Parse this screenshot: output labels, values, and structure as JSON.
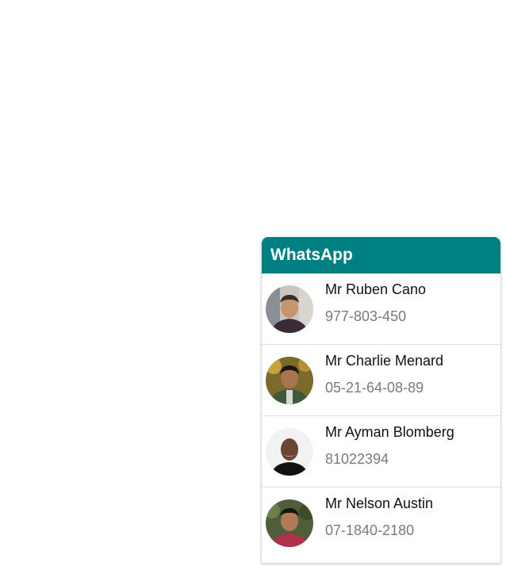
{
  "widget": {
    "title": "WhatsApp",
    "accent_color": "#008080"
  },
  "contacts": [
    {
      "name": "Mr Ruben Cano",
      "phone": "977-803-450",
      "avatar": "avatar-photo"
    },
    {
      "name": "Mr Charlie Menard",
      "phone": "05-21-64-08-89",
      "avatar": "avatar-photo"
    },
    {
      "name": "Mr Ayman Blomberg",
      "phone": "81022394",
      "avatar": "avatar-photo"
    },
    {
      "name": "Mr Nelson Austin",
      "phone": "07-1840-2180",
      "avatar": "avatar-photo"
    }
  ]
}
